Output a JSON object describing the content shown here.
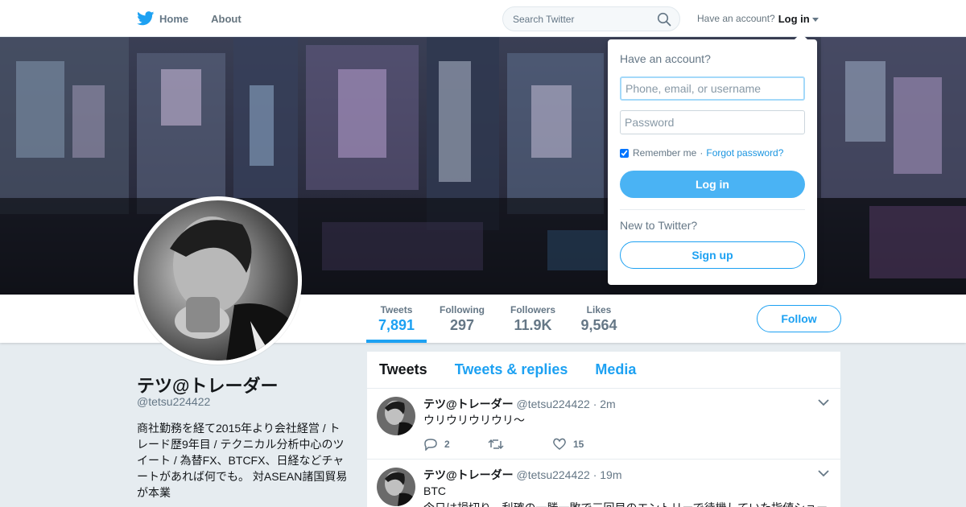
{
  "colors": {
    "accent": "#1da1f2",
    "background": "#e6ecf0",
    "text": "#14171a",
    "muted": "#657786"
  },
  "nav": {
    "home_label": "Home",
    "about_label": "About",
    "search_placeholder": "Search Twitter",
    "have_account": "Have an account?",
    "login_label": "Log in"
  },
  "profile": {
    "name": "テツ@トレーダー",
    "handle": "@tetsu224422",
    "bio": "商社勤務を経て2015年より会社経営 / トレード歴9年目 / テクニカル分析中心のツイート / 為替FX、BTCFX、日経などチャートがあれば何でも。 対ASEAN諸国貿易が本業"
  },
  "stats": [
    {
      "label": "Tweets",
      "value": "7,891"
    },
    {
      "label": "Following",
      "value": "297"
    },
    {
      "label": "Followers",
      "value": "11.9K"
    },
    {
      "label": "Likes",
      "value": "9,564"
    }
  ],
  "follow_label": "Follow",
  "tabs": [
    "Tweets",
    "Tweets & replies",
    "Media"
  ],
  "tweets": [
    {
      "name": "テツ@トレーダー",
      "handle": "@tetsu224422",
      "time": "· 2m",
      "text": "ウリウリウリウリ～",
      "replies": "2",
      "retweets": "",
      "likes": "15"
    },
    {
      "name": "テツ@トレーダー",
      "handle": "@tetsu224422",
      "time": "· 19m",
      "text": "BTC",
      "text2": "今日は損切り、利確の一勝一敗で三回目のエントリーで待機していた指値ショート"
    }
  ],
  "login_dropdown": {
    "title": "Have an account?",
    "username_placeholder": "Phone, email, or username",
    "password_placeholder": "Password",
    "remember_label": "Remember me",
    "separator": "·",
    "forgot_label": "Forgot password?",
    "login_button": "Log in",
    "new_label": "New to Twitter?",
    "signup_button": "Sign up"
  }
}
